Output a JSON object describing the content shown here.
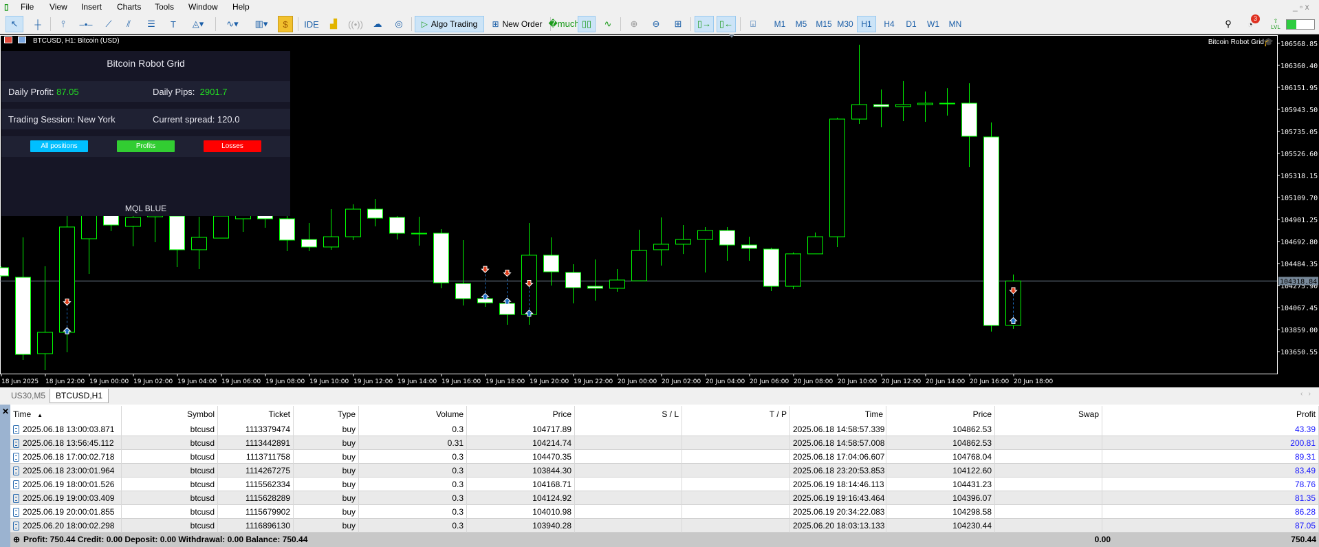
{
  "menu": [
    "File",
    "View",
    "Insert",
    "Charts",
    "Tools",
    "Window",
    "Help"
  ],
  "toolbar": {
    "ide_label": "IDE",
    "algo_trading_label": "Algo Trading",
    "new_order_label": "New Order",
    "timeframes": [
      "M1",
      "M5",
      "M15",
      "M30",
      "H1",
      "H4",
      "D1",
      "W1",
      "MN"
    ],
    "active_timeframe": "H1",
    "notification_count": "3",
    "lvl_label": "LVL",
    "level_fill_percent": 35
  },
  "chart": {
    "title": "BTCUSD, H1:  Bitcoin (USD)",
    "ea_name": "Bitcoin Robot Grid",
    "colors": {
      "background": "#000000",
      "bull_outline": "#00ff00",
      "bear_body": "#ffffff",
      "price_line": "#778899",
      "buy_arrow": "#1e6fc4",
      "sell_arrow": "#e0401e"
    }
  },
  "panel": {
    "title": "Bitcoin Robot Grid",
    "daily_profit_label": "Daily Profit:",
    "daily_profit_value": "87.05",
    "daily_pips_label": "Daily Pips:",
    "daily_pips_value": "2901.7",
    "session_label": "Trading Session: New York",
    "spread_label": "Current spread: 120.0",
    "buttons": [
      {
        "label": "All positions",
        "color": "#00bfff"
      },
      {
        "label": "Profits",
        "color": "#32cd32"
      },
      {
        "label": "Losses",
        "color": "#ff0000"
      }
    ],
    "footer": "MQL BLUE"
  },
  "chart_data": {
    "type": "candlestick",
    "symbol": "BTCUSD",
    "timeframe": "H1",
    "first_bar": "2025-06-18 20:00",
    "ohlc": [
      [
        104445,
        104458,
        104354,
        104367
      ],
      [
        104354,
        104732,
        103572,
        103624
      ],
      [
        103631,
        104458,
        103475,
        103833
      ],
      [
        103833,
        104966,
        103644,
        104830
      ],
      [
        104719,
        105025,
        104387,
        104966
      ],
      [
        104947,
        104993,
        104791,
        104849
      ],
      [
        104836,
        105025,
        104647,
        104921
      ],
      [
        104927,
        105025,
        104686,
        104953
      ],
      [
        104934,
        104992,
        104452,
        104615
      ],
      [
        104615,
        104927,
        104432,
        104732
      ],
      [
        104725,
        104992,
        104725,
        104934
      ],
      [
        104908,
        104992,
        104784,
        104947
      ],
      [
        104947,
        104992,
        104823,
        104908
      ],
      [
        104908,
        104947,
        104602,
        104706
      ],
      [
        104712,
        104869,
        104602,
        104641
      ],
      [
        104641,
        104999,
        104615,
        104738
      ],
      [
        104738,
        105045,
        104706,
        104999
      ],
      [
        104999,
        105097,
        104836,
        104914
      ],
      [
        104921,
        104934,
        104712,
        104771
      ],
      [
        104771,
        104927,
        104654,
        104771
      ],
      [
        104771,
        104810,
        104250,
        104302
      ],
      [
        104295,
        104706,
        104087,
        104152
      ],
      [
        104152,
        104158,
        104074,
        104113
      ],
      [
        104107,
        104107,
        103905,
        104002
      ],
      [
        104002,
        104869,
        103905,
        104563
      ],
      [
        104563,
        104732,
        104276,
        104406
      ],
      [
        104400,
        104478,
        104107,
        104256
      ],
      [
        104269,
        104523,
        104133,
        104250
      ],
      [
        104250,
        104432,
        104217,
        104328
      ],
      [
        104321,
        104804,
        104321,
        104608
      ],
      [
        104615,
        104921,
        104465,
        104667
      ],
      [
        104667,
        104849,
        104575,
        104712
      ],
      [
        104712,
        104830,
        104400,
        104797
      ],
      [
        104797,
        104830,
        104510,
        104660
      ],
      [
        104660,
        104738,
        104510,
        104628
      ],
      [
        104621,
        104634,
        104224,
        104269
      ],
      [
        104269,
        104589,
        104243,
        104576
      ],
      [
        104576,
        104778,
        104576,
        104738
      ],
      [
        104738,
        105865,
        104641,
        105852
      ],
      [
        105852,
        106556,
        105807,
        105989
      ],
      [
        105989,
        106132,
        105774,
        105970
      ],
      [
        105970,
        106211,
        105833,
        105989
      ],
      [
        105989,
        106113,
        105826,
        106002
      ],
      [
        106002,
        106145,
        105885,
        106002
      ],
      [
        106002,
        106191,
        105396,
        105689
      ],
      [
        105683,
        105820,
        103840,
        103898
      ],
      [
        103898,
        104380,
        103866,
        104319
      ]
    ],
    "y_ticks": [
      "106568.85",
      "106360.40",
      "106151.95",
      "105943.50",
      "105735.05",
      "105526.60",
      "105318.15",
      "105109.70",
      "104901.25",
      "104692.80",
      "104484.35",
      "104275.90",
      "104067.45",
      "103859.00",
      "103650.55"
    ],
    "current_price": "104318.84",
    "x_ticks": [
      "18 Jun 2025",
      "18 Jun 22:00",
      "19 Jun 00:00",
      "19 Jun 02:00",
      "19 Jun 04:00",
      "19 Jun 06:00",
      "19 Jun 08:00",
      "19 Jun 10:00",
      "19 Jun 12:00",
      "19 Jun 14:00",
      "19 Jun 16:00",
      "19 Jun 18:00",
      "19 Jun 20:00",
      "19 Jun 22:00",
      "20 Jun 00:00",
      "20 Jun 02:00",
      "20 Jun 04:00",
      "20 Jun 06:00",
      "20 Jun 08:00",
      "20 Jun 10:00",
      "20 Jun 12:00",
      "20 Jun 14:00",
      "20 Jun 16:00",
      "20 Jun 18:00"
    ]
  },
  "tabs": [
    {
      "label": "US30,M5",
      "active": false
    },
    {
      "label": "BTCUSD,H1",
      "active": true
    }
  ],
  "trades": {
    "columns": [
      "Time",
      "Symbol",
      "Ticket",
      "Type",
      "Volume",
      "Price",
      "S / L",
      "T / P",
      "Time",
      "Price",
      "Swap",
      "Profit"
    ],
    "rows": [
      [
        "2025.06.18 13:00:03.871",
        "btcusd",
        "1113379474",
        "buy",
        "0.3",
        "104717.89",
        "",
        "",
        "2025.06.18 14:58:57.339",
        "104862.53",
        "",
        "43.39"
      ],
      [
        "2025.06.18 13:56:45.112",
        "btcusd",
        "1113442891",
        "buy",
        "0.31",
        "104214.74",
        "",
        "",
        "2025.06.18 14:58:57.008",
        "104862.53",
        "",
        "200.81"
      ],
      [
        "2025.06.18 17:00:02.718",
        "btcusd",
        "1113711758",
        "buy",
        "0.3",
        "104470.35",
        "",
        "",
        "2025.06.18 17:04:06.607",
        "104768.04",
        "",
        "89.31"
      ],
      [
        "2025.06.18 23:00:01.964",
        "btcusd",
        "1114267275",
        "buy",
        "0.3",
        "103844.30",
        "",
        "",
        "2025.06.18 23:20:53.853",
        "104122.60",
        "",
        "83.49"
      ],
      [
        "2025.06.19 18:00:01.526",
        "btcusd",
        "1115562334",
        "buy",
        "0.3",
        "104168.71",
        "",
        "",
        "2025.06.19 18:14:46.113",
        "104431.23",
        "",
        "78.76"
      ],
      [
        "2025.06.19 19:00:03.409",
        "btcusd",
        "1115628289",
        "buy",
        "0.3",
        "104124.92",
        "",
        "",
        "2025.06.19 19:16:43.464",
        "104396.07",
        "",
        "81.35"
      ],
      [
        "2025.06.19 20:00:01.855",
        "btcusd",
        "1115679902",
        "buy",
        "0.3",
        "104010.98",
        "",
        "",
        "2025.06.19 20:34:22.083",
        "104298.58",
        "",
        "86.28"
      ],
      [
        "2025.06.20 18:00:02.298",
        "btcusd",
        "1116896130",
        "buy",
        "0.3",
        "103940.28",
        "",
        "",
        "2025.06.20 18:03:13.133",
        "104230.44",
        "",
        "87.05"
      ]
    ],
    "summary": "Profit: 750.44  Credit: 0.00  Deposit: 0.00  Withdrawal: 0.00  Balance: 750.44",
    "swap_total": "0.00",
    "profit_total": "750.44"
  }
}
